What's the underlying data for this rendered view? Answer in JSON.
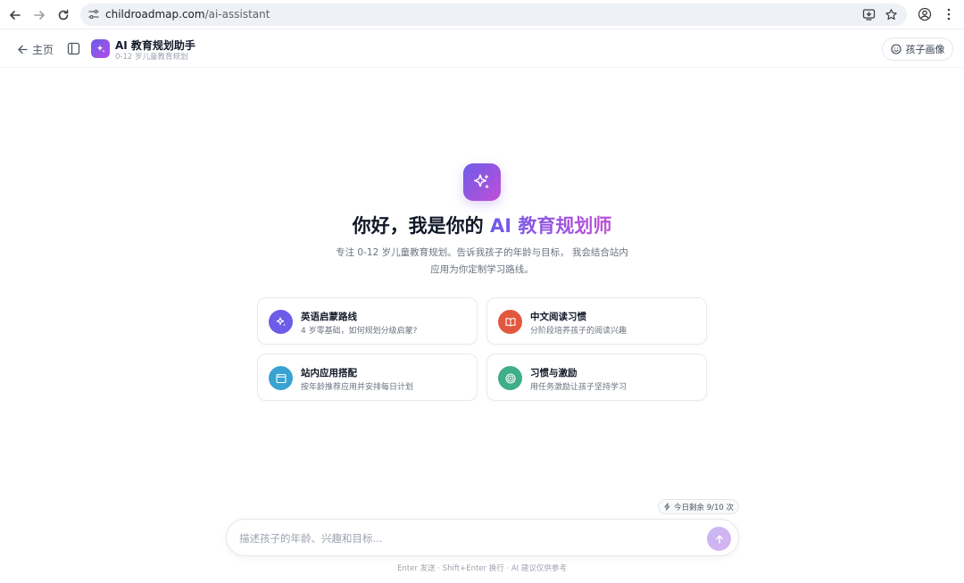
{
  "browser": {
    "url_host": "childroadmap.com",
    "url_path": "/ai-assistant"
  },
  "header": {
    "back_label": "主页",
    "brand_title": "AI 教育规划助手",
    "brand_subtitle": "0-12 岁儿童教育规划",
    "profile_button_label": "孩子画像"
  },
  "hero": {
    "title_prefix": "你好，我是你的 ",
    "title_accent": "AI 教育规划师",
    "description_line1": "专注 0-12 岁儿童教育规划。告诉我孩子的年龄与目标， 我会结合站内",
    "description_line2": "应用为你定制学习路线。"
  },
  "suggestions": [
    {
      "title": "英语启蒙路线",
      "description": "4 岁零基础，如何规划分级启蒙?",
      "icon": "sparkles-icon",
      "color": "#6d5ce8"
    },
    {
      "title": "中文阅读习惯",
      "description": "分阶段培养孩子的阅读兴趣",
      "icon": "book-icon",
      "color": "#e2583e"
    },
    {
      "title": "站内应用搭配",
      "description": "按年龄推荐应用并安排每日计划",
      "icon": "app-window-icon",
      "color": "#38a3d1"
    },
    {
      "title": "习惯与激励",
      "description": "用任务激励让孩子坚持学习",
      "icon": "target-icon",
      "color": "#3fae8a"
    }
  ],
  "quota": {
    "label": "今日剩余 9/10 次"
  },
  "input": {
    "placeholder": "描述孩子的年龄、兴趣和目标..."
  },
  "footer": {
    "hint": "Enter 发送 · Shift+Enter 换行 · AI 建议仅供参考"
  }
}
